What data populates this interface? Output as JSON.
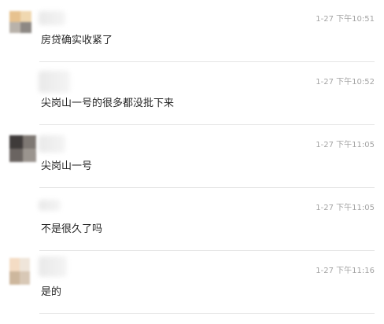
{
  "comments": [
    {
      "time": "1-27 下午10:51",
      "text": "房贷确实收紧了",
      "avatar_colors": [
        "#e7c28f",
        "#f0d8b0",
        "#b9b2aa",
        "#8d8884"
      ]
    },
    {
      "time": "1-27 下午10:52",
      "text": "尖岗山一号的很多都没批下来",
      "avatar_colors": [
        "#ffffff",
        "#ffffff",
        "#ffffff",
        "#ffffff"
      ]
    },
    {
      "time": "1-27 下午11:05",
      "text": "尖岗山一号",
      "avatar_colors": [
        "#3f3b3a",
        "#7e7873",
        "#6a6461",
        "#9a948e"
      ]
    },
    {
      "time": "1-27 下午11:05",
      "text": "不是很久了吗",
      "avatar_colors": [
        "#ffffff",
        "#ffffff",
        "#ffffff",
        "#ffffff"
      ]
    },
    {
      "time": "1-27 下午11:16",
      "text": "是的",
      "avatar_colors": [
        "#f4dcc4",
        "#efe5da",
        "#cdb79d",
        "#d8c8b6"
      ]
    }
  ]
}
